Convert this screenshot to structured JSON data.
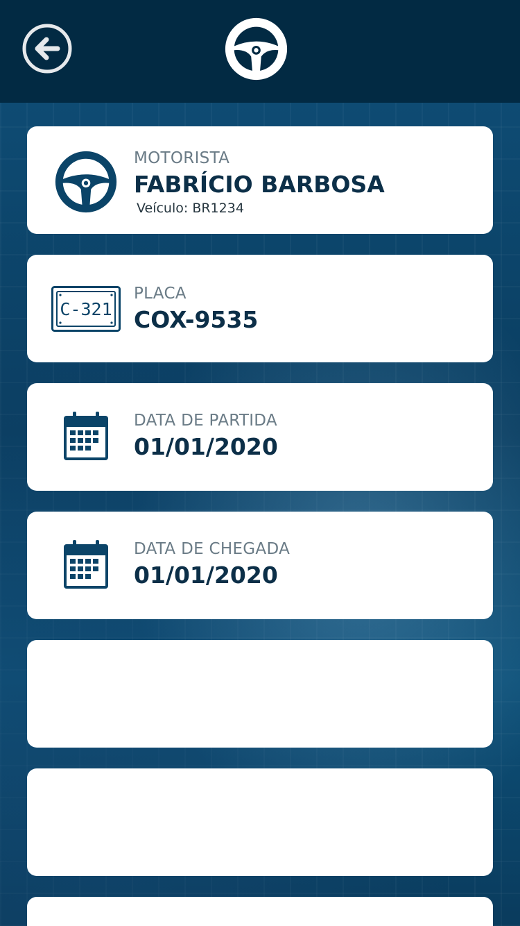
{
  "header": {
    "back_icon": "arrow-left-circle-icon",
    "logo_icon": "steering-wheel-icon"
  },
  "cards": {
    "driver": {
      "icon": "steering-wheel-icon",
      "label": "MOTORISTA",
      "value": "FABRÍCIO BARBOSA",
      "sub": "Veículo: BR1234"
    },
    "plate": {
      "icon": "license-plate-icon",
      "plate_icon_text": "C-321",
      "label": "PLACA",
      "value": "COX-9535"
    },
    "departure": {
      "icon": "calendar-icon",
      "label": "DATA DE PARTIDA",
      "value": "01/01/2020"
    },
    "arrival": {
      "icon": "calendar-icon",
      "label": "DATA DE CHEGADA",
      "value": "01/01/2020"
    }
  },
  "colors": {
    "header_bg": "#022a43",
    "accent": "#0b4468",
    "card_bg": "#ffffff",
    "label": "#6a7b86",
    "value": "#0c2f48"
  }
}
